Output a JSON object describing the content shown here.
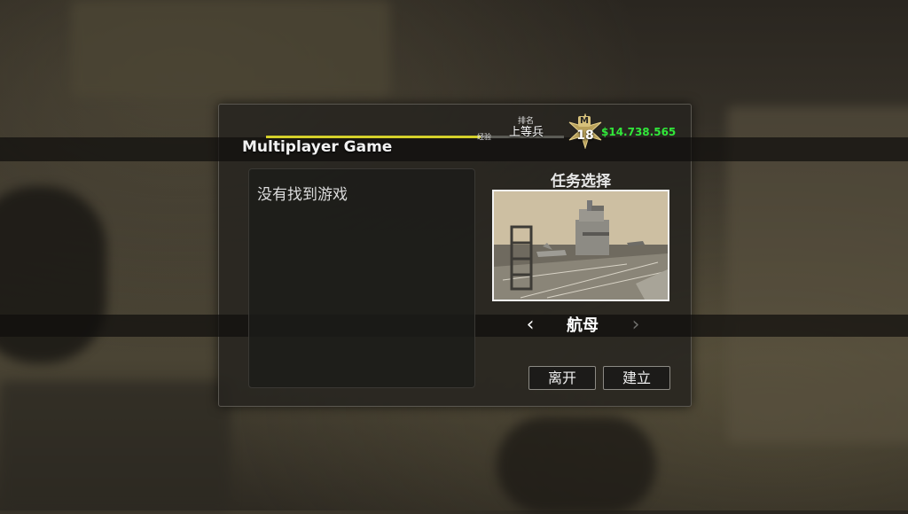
{
  "header": {
    "title": "Multiplayer Game",
    "xp_label": "经验",
    "xp_progress": 0.72,
    "rank_caption": "排名",
    "rank_name": "上等兵",
    "rank_level": "18",
    "rank_badge_letter": "M",
    "money": "$14.738.565",
    "colors": {
      "xp_bar": "#d4d02a",
      "money": "#31e83a"
    }
  },
  "game_list": {
    "empty_message": "没有找到游戏"
  },
  "mission": {
    "title": "任务选择",
    "selected_map": "航母",
    "prev_icon": "chevron-left-icon",
    "next_icon": "chevron-right-icon"
  },
  "buttons": {
    "leave": "离开",
    "create": "建立"
  }
}
